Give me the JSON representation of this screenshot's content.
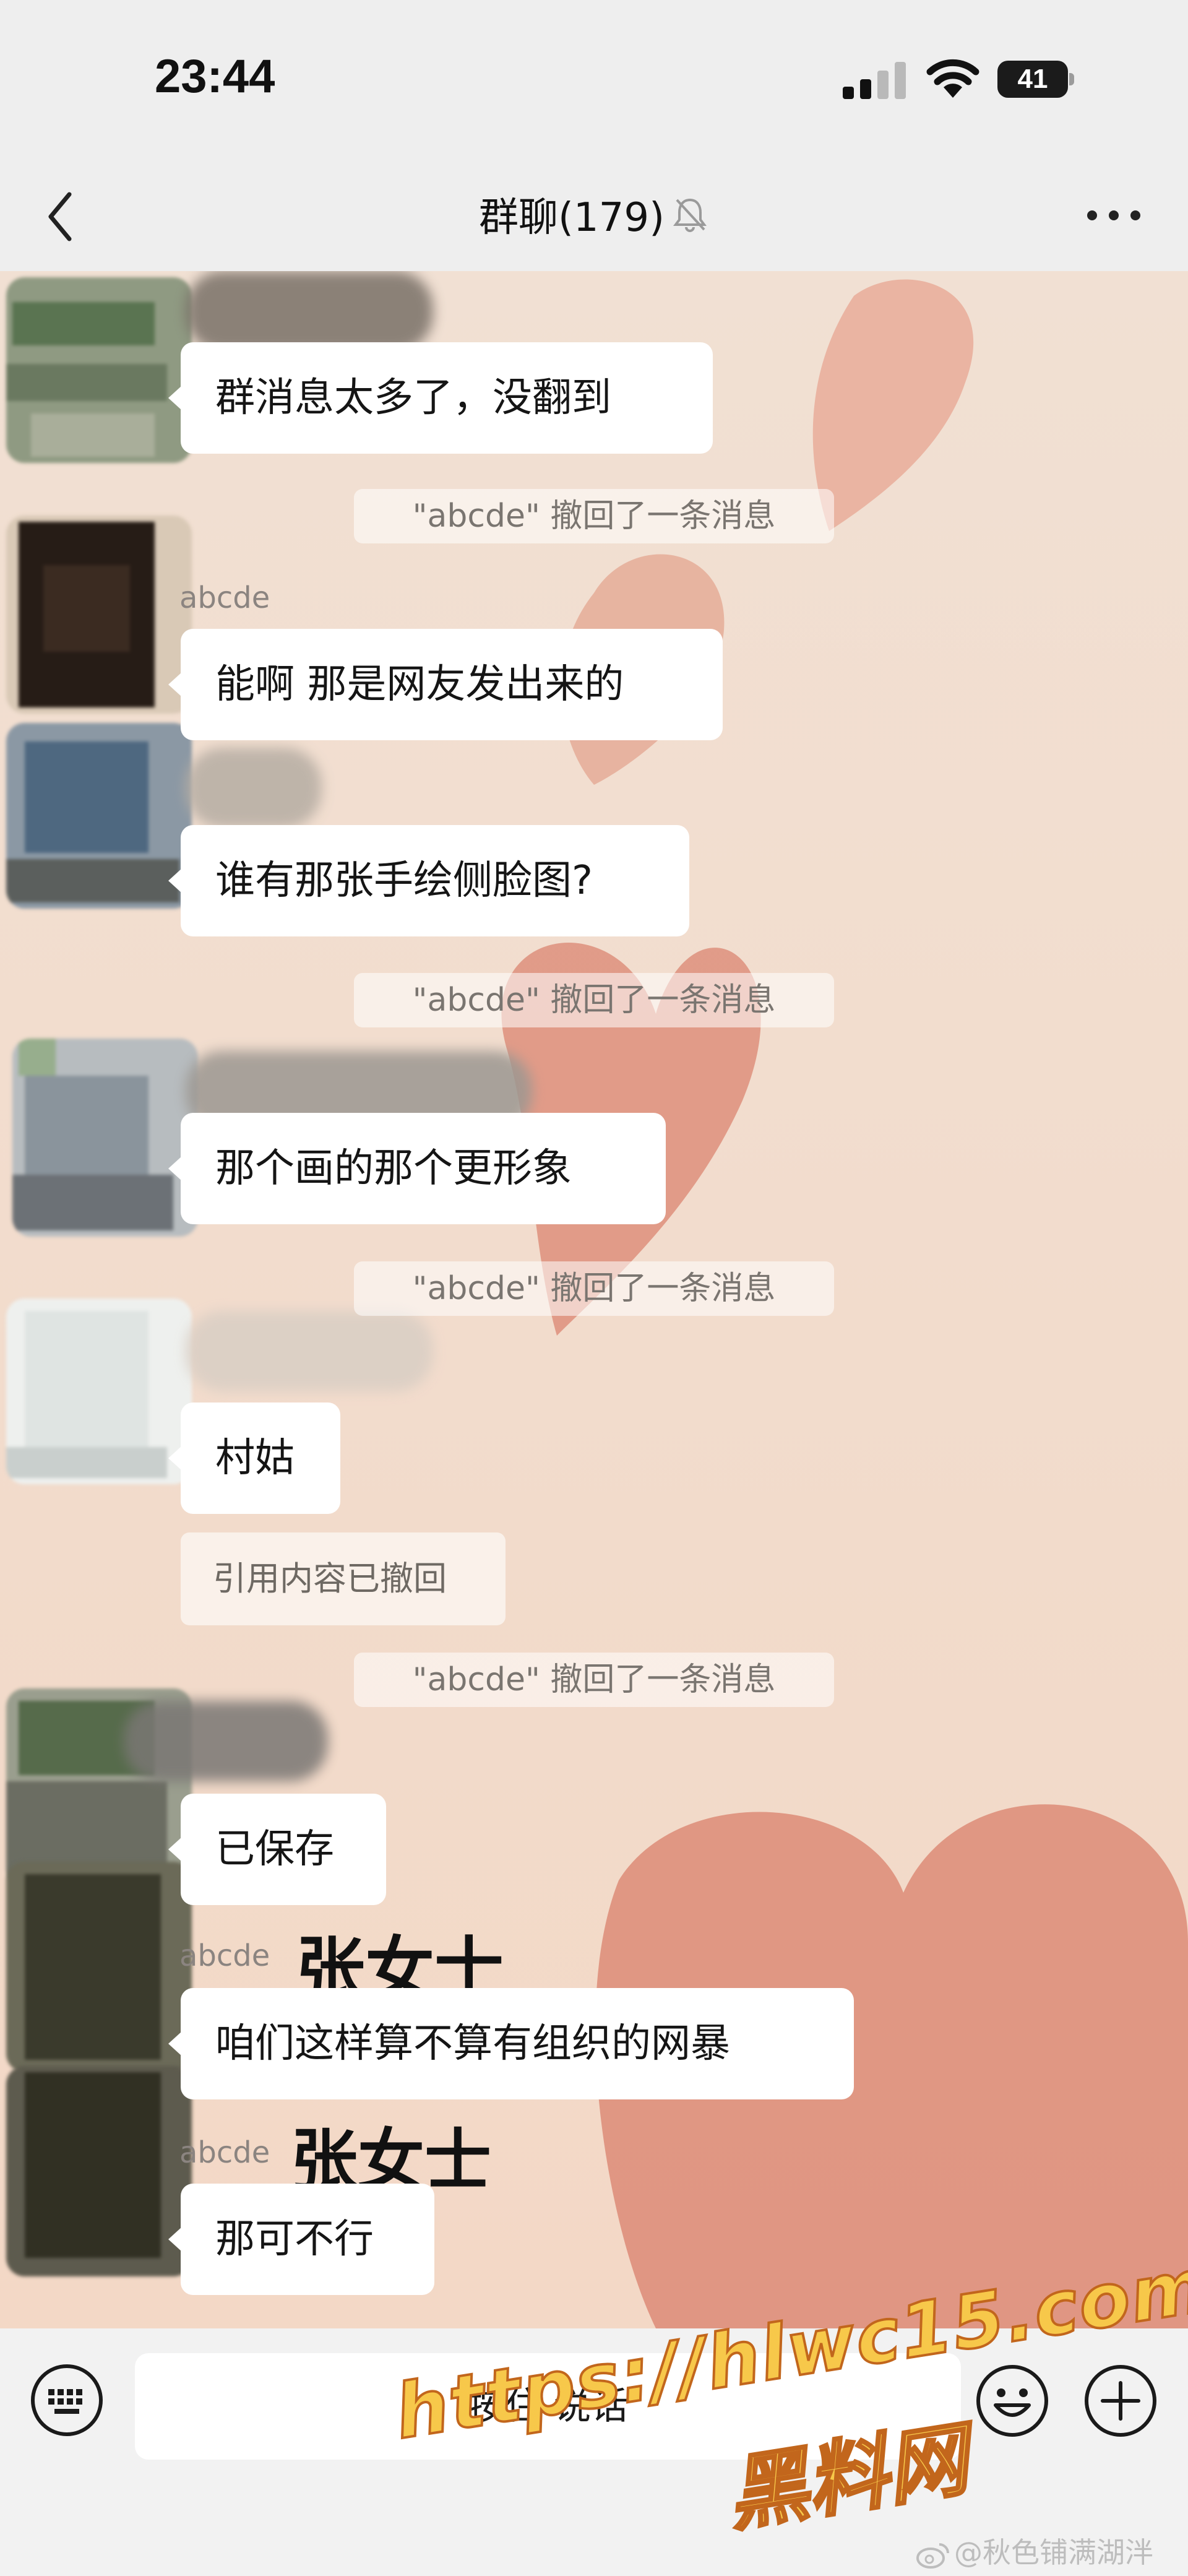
{
  "status_bar": {
    "time": "23:44",
    "battery": "41",
    "signal_icon": "cellular-signal-icon",
    "wifi_icon": "wifi-icon"
  },
  "nav": {
    "title": "群聊(179)",
    "back_icon": "chevron-left-icon",
    "mute_icon": "bell-slash-icon",
    "more_icon": "ellipsis-icon"
  },
  "messages": {
    "m1": "群消息太多了，没翻到",
    "sys1": "\"abcde\" 撤回了一条消息",
    "m2_sender": "abcde",
    "m2": "能啊 那是网友发出来的",
    "m3": "谁有那张手绘侧脸图?",
    "sys2": "\"abcde\" 撤回了一条消息",
    "m4": "那个画的那个更形象",
    "sys3": "\"abcde\" 撤回了一条消息",
    "m5": "村姑",
    "quote": "引用内容已撤回",
    "sys4": "\"abcde\" 撤回了一条消息",
    "m6": "已保存",
    "m7_sender": "abcde",
    "m7_overlay": "张女士",
    "m7": "咱们这样算不算有组织的网暴",
    "m8_sender": "abcde",
    "m8_overlay": "张女士",
    "m8": "那可不行"
  },
  "input_bar": {
    "hold_to_talk": "按住 说话",
    "keyboard_icon": "keyboard-icon",
    "emoji_icon": "emoji-icon",
    "plus_icon": "plus-circle-icon"
  },
  "watermark": {
    "url": "https://hlwc15.com",
    "site": "黑料网",
    "weibo": "@秋色铺满湖泮"
  },
  "colors": {
    "chat_bg": "#f2dccc",
    "heart": "#dc8b77",
    "bubble": "#ffffff",
    "watermark_fill": "#f7c84a",
    "watermark_stroke": "#c2661c"
  }
}
